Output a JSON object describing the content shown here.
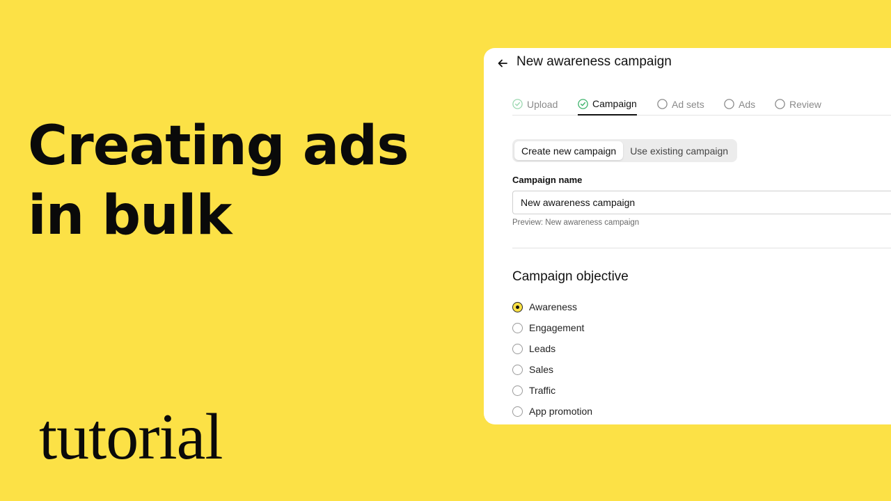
{
  "hero": {
    "title_line1": "Creating ads",
    "title_line2": "in bulk",
    "subtitle": "tutorial"
  },
  "panel": {
    "back_icon": "arrow-left-icon",
    "title": "New awareness campaign",
    "steps": [
      {
        "label": "Upload",
        "state": "completed"
      },
      {
        "label": "Campaign",
        "state": "active"
      },
      {
        "label": "Ad sets",
        "state": "pending"
      },
      {
        "label": "Ads",
        "state": "pending"
      },
      {
        "label": "Review",
        "state": "pending"
      }
    ],
    "mode_toggle": {
      "options": [
        "Create new campaign",
        "Use existing campaign"
      ],
      "selected": "Create new campaign"
    },
    "campaign_name": {
      "label": "Campaign name",
      "value": "New awareness campaign",
      "preview": "Preview: New awareness campaign"
    },
    "objective": {
      "heading": "Campaign objective",
      "options": [
        "Awareness",
        "Engagement",
        "Leads",
        "Sales",
        "Traffic",
        "App promotion"
      ],
      "selected": "Awareness"
    }
  },
  "colors": {
    "background": "#FCE146",
    "step_done": "#3DB36B",
    "radio_selected_fill": "#FCE146"
  }
}
